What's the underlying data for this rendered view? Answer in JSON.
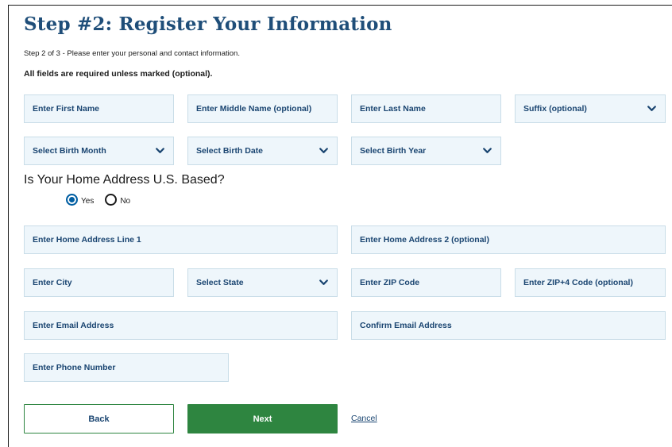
{
  "header": {
    "title": "Step #2: Register Your Information",
    "subtitle": "Step 2 of 3 - Please enter your personal and contact information.",
    "required_note": "All fields are required unless marked (optional)."
  },
  "name_row": {
    "first_name": "Enter First Name",
    "middle_name": "Enter Middle Name (optional)",
    "last_name": "Enter Last Name",
    "suffix": "Suffix (optional)"
  },
  "birth_row": {
    "month": "Select Birth Month",
    "date": "Select Birth Date",
    "year": "Select Birth Year"
  },
  "address_question": {
    "text": "Is Your Home Address U.S. Based?",
    "options": [
      {
        "label": "Yes",
        "selected": true
      },
      {
        "label": "No",
        "selected": false
      }
    ]
  },
  "address": {
    "line1": "Enter Home Address Line 1",
    "line2": "Enter Home Address 2 (optional)",
    "city": "Enter City",
    "state": "Select State",
    "zip": "Enter ZIP Code",
    "zip4": "Enter ZIP+4 Code (optional)"
  },
  "contact": {
    "email": "Enter Email Address",
    "confirm_email": "Confirm Email Address",
    "phone": "Enter Phone Number"
  },
  "actions": {
    "back": "Back",
    "next": "Next",
    "cancel": "Cancel"
  },
  "colors": {
    "title": "#1f4e79",
    "field_bg": "#eef6fb",
    "field_border": "#c9dde8",
    "field_text": "#1a4571",
    "next_button": "#2e8540",
    "radio_selected": "#005ea2"
  },
  "icons": {
    "select_chevron": "chevron-down-icon"
  }
}
